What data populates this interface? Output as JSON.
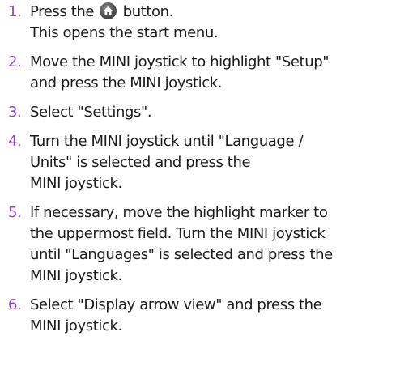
{
  "steps": [
    {
      "number": "1.",
      "lines": [
        "Press the",
        "button.",
        "This opens the start menu."
      ],
      "icon": "home-button-icon"
    },
    {
      "number": "2.",
      "lines": [
        "Move the MINI joystick to highlight \"Setup\"",
        "and press the MINI joystick."
      ]
    },
    {
      "number": "3.",
      "lines": [
        "Select \"Settings\"."
      ]
    },
    {
      "number": "4.",
      "lines": [
        "Turn the MINI joystick until \"Language /",
        "Units\" is selected and press the",
        "MINI joystick."
      ]
    },
    {
      "number": "5.",
      "lines": [
        "If necessary, move the highlight marker to",
        "the uppermost field. Turn the MINI joystick",
        "until \"Languages\" is selected and press the",
        "MINI joystick."
      ]
    },
    {
      "number": "6.",
      "lines": [
        "Select \"Display arrow view\" and press the",
        "MINI joystick."
      ]
    }
  ],
  "colors": {
    "step_number": "#8e45c8",
    "text": "#1a1a1a"
  }
}
